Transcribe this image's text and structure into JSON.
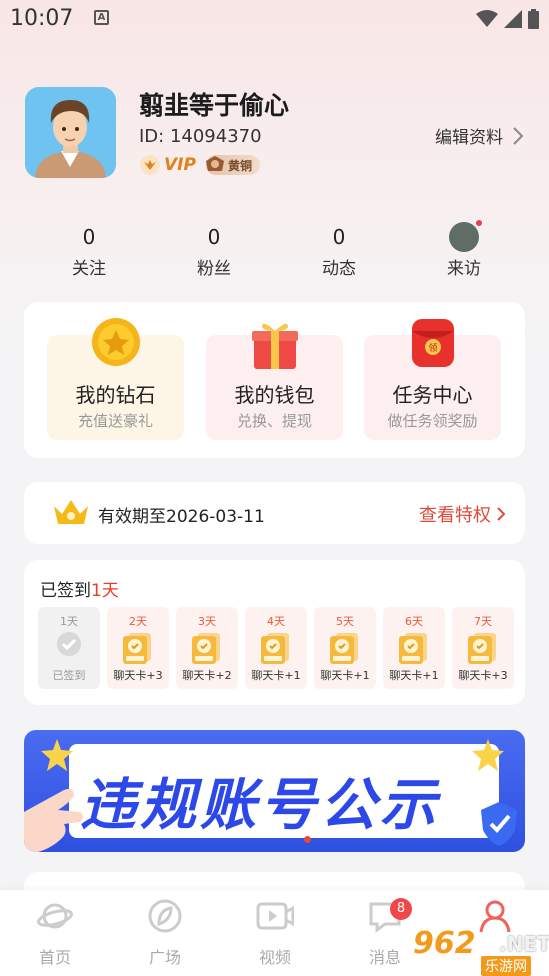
{
  "status_bar": {
    "time": "10:07",
    "notif_letter": "A"
  },
  "profile": {
    "name": "翦韭等于偷心",
    "id_text": "ID: 14094370",
    "vip_label": "VIP",
    "rank_label": "黄铜",
    "edit_label": "编辑资料"
  },
  "stats": [
    {
      "value": "0",
      "label": "关注"
    },
    {
      "value": "0",
      "label": "粉丝"
    },
    {
      "value": "0",
      "label": "动态"
    },
    {
      "label": "来访"
    }
  ],
  "wallet": [
    {
      "title": "我的钻石",
      "sub": "充值送豪礼",
      "bg": "#fdf6e6"
    },
    {
      "title": "我的钱包",
      "sub": "兑换、提现",
      "bg": "#fdeef0"
    },
    {
      "title": "任务中心",
      "sub": "做任务领奖励",
      "bg": "#fdeef0"
    }
  ],
  "vip_bar": {
    "expire": "有效期至2026-03-11",
    "link": "查看特权"
  },
  "signin": {
    "prefix": "已签到",
    "days_count": "1天",
    "days": [
      {
        "label": "1天",
        "reward": "已签到",
        "done": true
      },
      {
        "label": "2天",
        "reward": "聊天卡+3",
        "done": false
      },
      {
        "label": "3天",
        "reward": "聊天卡+2",
        "done": false
      },
      {
        "label": "4天",
        "reward": "聊天卡+1",
        "done": false
      },
      {
        "label": "5天",
        "reward": "聊天卡+1",
        "done": false
      },
      {
        "label": "6天",
        "reward": "聊天卡+1",
        "done": false
      },
      {
        "label": "7天",
        "reward": "聊天卡+3",
        "done": false
      }
    ]
  },
  "banner": {
    "text": "违规账号公示"
  },
  "nav": [
    {
      "label": "首页",
      "icon": "planet-icon"
    },
    {
      "label": "广场",
      "icon": "leaf-icon"
    },
    {
      "label": "视频",
      "icon": "video-icon"
    },
    {
      "label": "消息",
      "icon": "message-icon",
      "badge": "8"
    },
    {
      "label": "",
      "icon": "profile-icon"
    }
  ],
  "watermark": {
    "num": "962",
    "net": ".NET",
    "site": "乐游网"
  },
  "colors": {
    "accent_red": "#e04a3a",
    "vip_orange": "#e0821c",
    "banner_blue": "#2f4fe0"
  }
}
